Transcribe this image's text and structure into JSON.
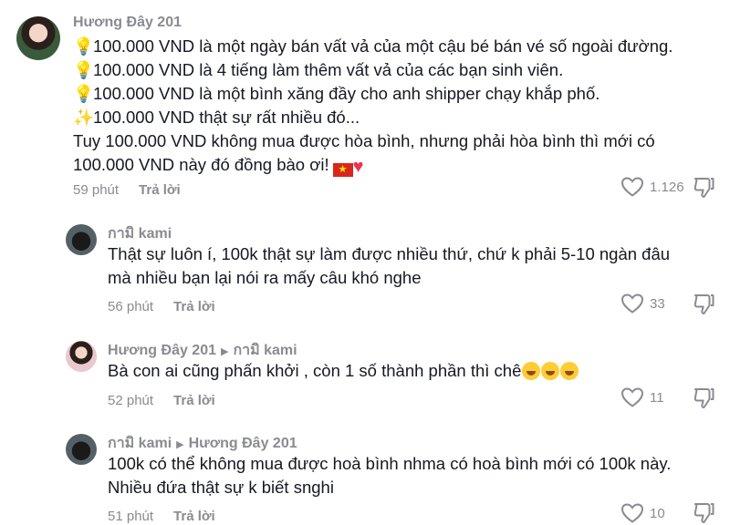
{
  "comments": [
    {
      "username": "Hương Đây 201",
      "lines": [
        {
          "icon": "💡",
          "text": "100.000 VND là một ngày bán vất vả của một cậu bé bán vé số ngoài đường."
        },
        {
          "icon": "💡",
          "text": "100.000 VND là 4 tiếng làm thêm vất vả của các bạn sinh viên."
        },
        {
          "icon": "💡",
          "text": "100.000 VND là một bình xăng đầy cho anh shipper chạy khắp phố."
        },
        {
          "icon": "✨",
          "text": "100.000 VND thật sự rất nhiều đó..."
        },
        {
          "icon": "",
          "text": "Tuy 100.000 VND không mua được hòa bình, nhưng phải hòa bình thì mới có"
        },
        {
          "icon": "",
          "text": "100.000 VND này đó đồng bào ơi!"
        }
      ],
      "time": "59 phút",
      "reply": "Trả lời",
      "likes": "1.126"
    },
    {
      "username": "กามิ kami",
      "lines": [
        {
          "text": "Thật sự luôn í, 100k thật sự làm được nhiều thứ, chứ k phải 5-10 ngàn đâu"
        },
        {
          "text": "mà nhiều bạn lại nói ra mấy câu khó nghe"
        }
      ],
      "time": "56 phút",
      "reply": "Trả lời",
      "likes": "33"
    },
    {
      "username": "Hương Đây 201",
      "reply_to": "กามิ kami",
      "lines": [
        {
          "text": "Bà con ai cũng phấn khởi , còn 1 số thành phần thì chê"
        }
      ],
      "time": "52 phút",
      "reply": "Trả lời",
      "likes": "11"
    },
    {
      "username": "กามิ kami",
      "reply_to": "Hương Đây 201",
      "lines": [
        {
          "text": "100k có thể không mua được hoà bình nhma có hoà bình mới có 100k này."
        },
        {
          "text": "Nhiều đứa thật sự k biết snghi"
        }
      ],
      "time": "51 phút",
      "reply": "Trả lời",
      "likes": "10"
    }
  ],
  "icons": {
    "like": "heart-outline-icon",
    "dislike": "thumbs-down-outline-icon",
    "flag": "vietnam-flag-emoji",
    "heart": "red-heart-emoji",
    "laugh": "tears-of-joy-emoji",
    "arrow": "reply-arrow-icon"
  },
  "colors": {
    "text": "#161823",
    "muted": "#8a8b91",
    "background": "#ffffff"
  }
}
